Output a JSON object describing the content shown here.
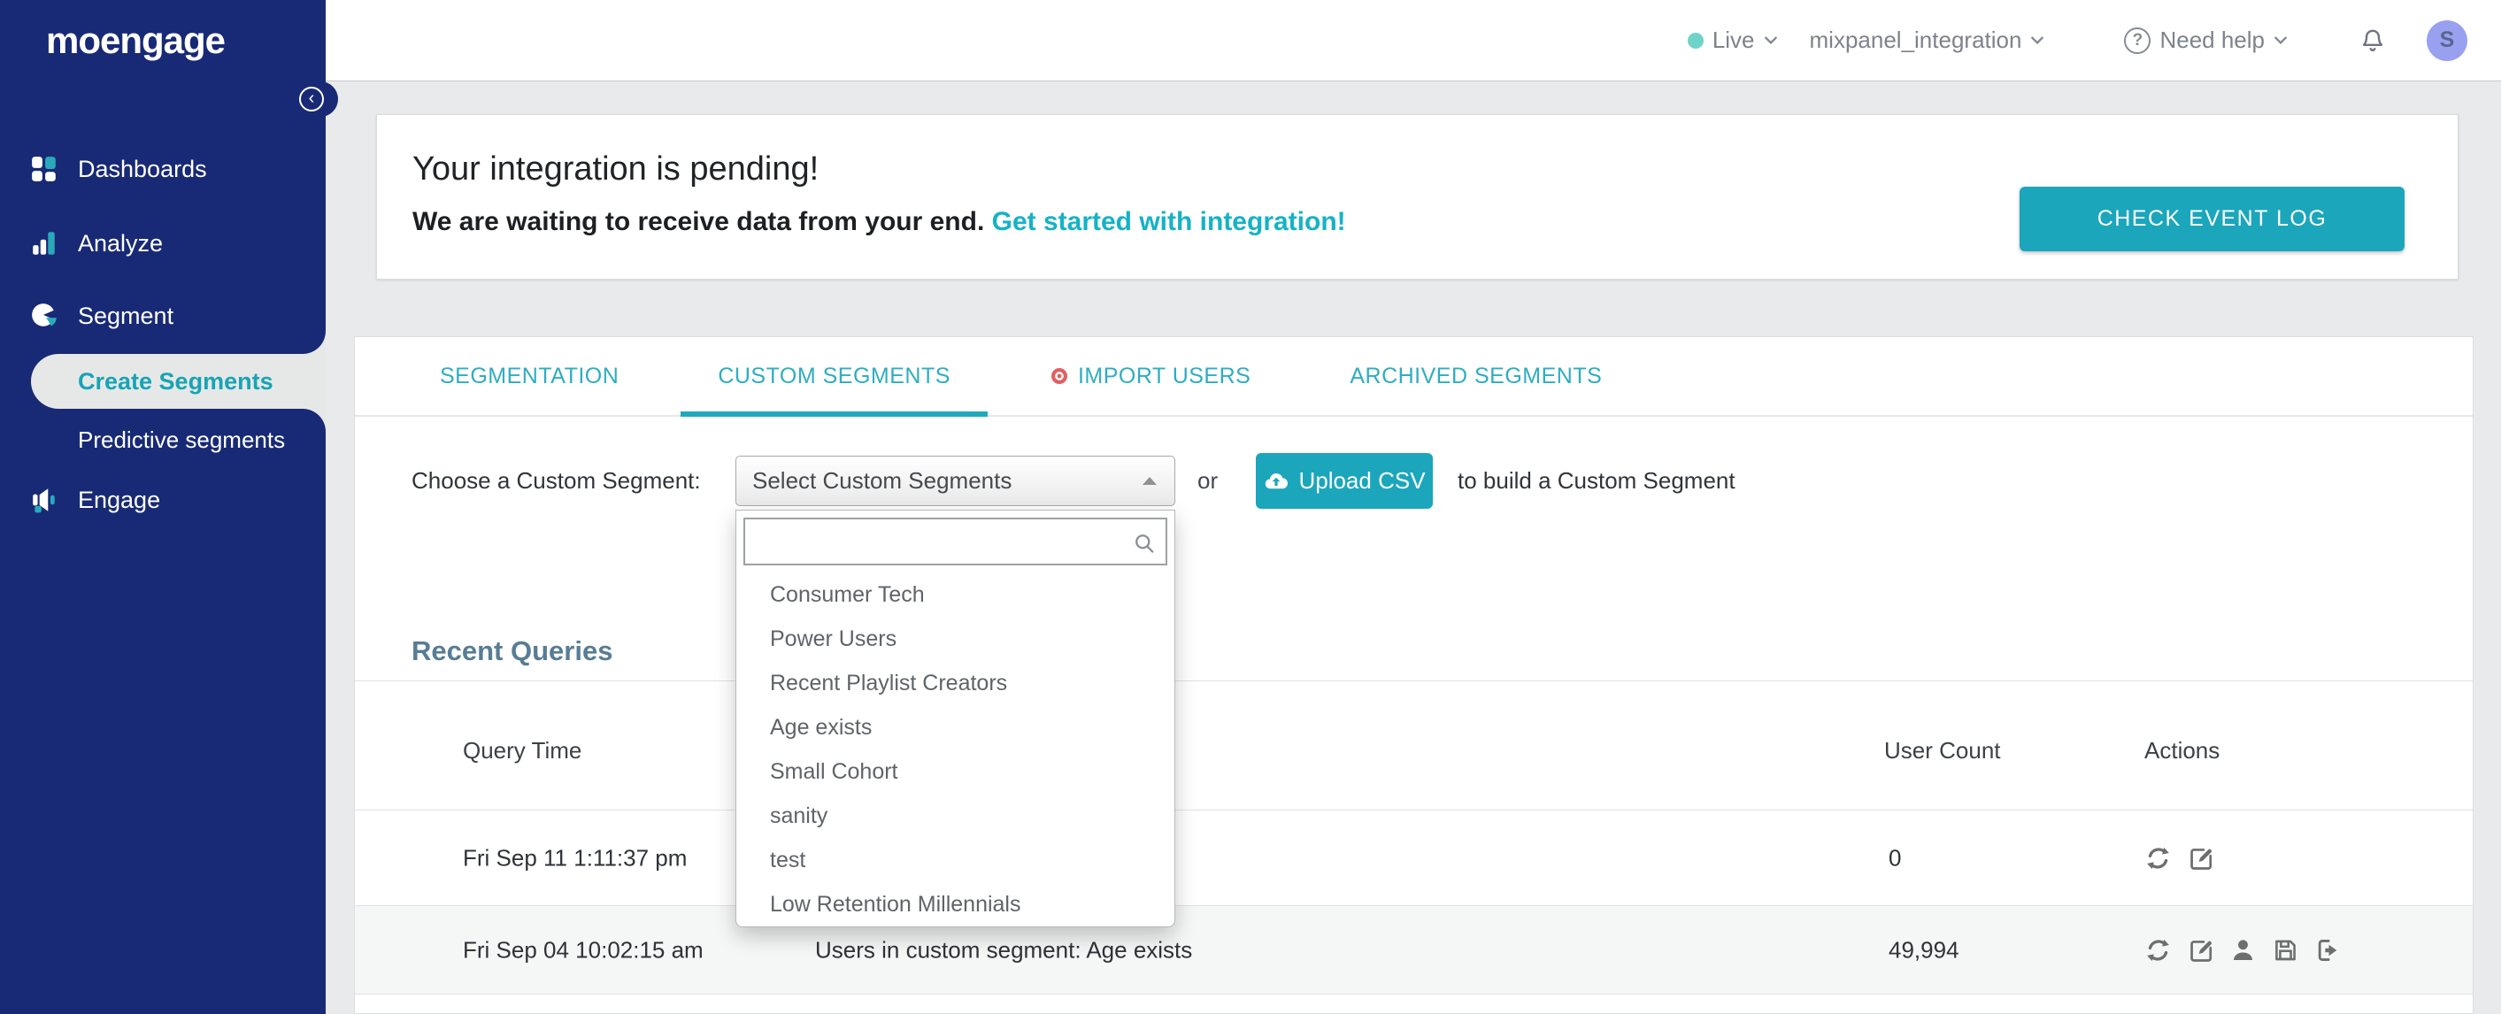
{
  "brand": {
    "logo": "moengage"
  },
  "topbar": {
    "live_label": "Live",
    "workspace": "mixpanel_integration",
    "help_label": "Need help",
    "avatar_initial": "S"
  },
  "sidebar": {
    "items": [
      {
        "label": "Dashboards",
        "icon": "dashboards-icon"
      },
      {
        "label": "Analyze",
        "icon": "analyze-icon"
      },
      {
        "label": "Segment",
        "icon": "segment-icon"
      },
      {
        "label": "Engage",
        "icon": "engage-icon"
      }
    ],
    "sub_items": [
      {
        "label": "Create Segments",
        "active": true
      },
      {
        "label": "Predictive segments",
        "active": false
      }
    ]
  },
  "banner": {
    "title": "Your integration is pending!",
    "subtitle": "We are waiting to receive data from your end. ",
    "link_text": "Get started with integration!",
    "button_label": "CHECK EVENT LOG"
  },
  "tabs": [
    {
      "label": "SEGMENTATION",
      "active": false
    },
    {
      "label": "CUSTOM SEGMENTS",
      "active": true
    },
    {
      "label": "IMPORT USERS",
      "active": false,
      "badge": "record-dot-icon"
    },
    {
      "label": "ARCHIVED SEGMENTS",
      "active": false
    }
  ],
  "chooser": {
    "label": "Choose a Custom Segment:",
    "select_value": "Select Custom Segments",
    "or_text": "or",
    "upload_label": "Upload CSV",
    "suffix": "to build a Custom Segment"
  },
  "dropdown": {
    "search_value": "",
    "search_placeholder": "",
    "items": [
      "Consumer Tech",
      "Power Users",
      "Recent Playlist Creators",
      "Age exists",
      "Small Cohort",
      "sanity",
      "test",
      "Low Retention Millennials"
    ]
  },
  "recent_queries": {
    "heading": "Recent Queries",
    "columns": [
      "Query Time",
      "User Count",
      "Actions"
    ],
    "rows": [
      {
        "time": "Fri Sep 11 1:11:37 pm",
        "query": "",
        "user_count": "0",
        "actions": [
          "refresh",
          "edit"
        ]
      },
      {
        "time": "Fri Sep 04 10:02:15 am",
        "query": "Users in custom segment: Age exists",
        "user_count": "49,994",
        "actions": [
          "refresh",
          "edit",
          "user",
          "save",
          "export"
        ]
      }
    ]
  },
  "colors": {
    "accent_teal": "#1ba6bc",
    "sidebar_navy": "#182a75",
    "live_dot": "#6fd3c8",
    "import_badge": "#e06060",
    "avatar_bg": "#9aa0f0",
    "page_bg": "#e9eaeb",
    "heading_slate": "#587d95"
  }
}
